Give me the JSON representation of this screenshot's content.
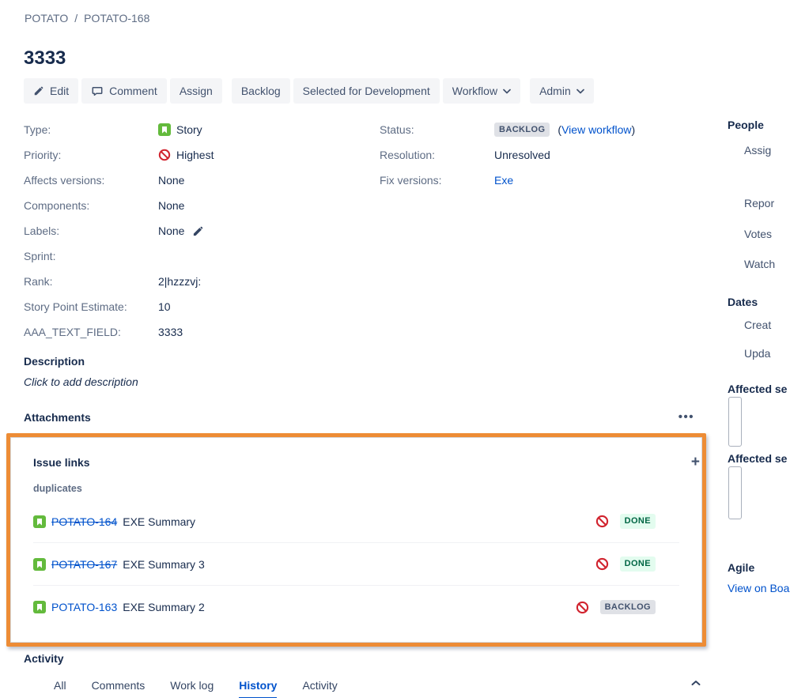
{
  "breadcrumb": {
    "project": "POTATO",
    "separator": "/",
    "issue": "POTATO-168"
  },
  "title": "3333",
  "toolbar": {
    "edit": "Edit",
    "comment": "Comment",
    "assign": "Assign",
    "backlog": "Backlog",
    "selected_for_development": "Selected for Development",
    "workflow": "Workflow",
    "admin": "Admin"
  },
  "details": {
    "left": [
      {
        "label": "Type:",
        "value": "Story"
      },
      {
        "label": "Priority:",
        "value": "Highest"
      },
      {
        "label": "Affects versions:",
        "value": "None"
      },
      {
        "label": "Components:",
        "value": "None"
      },
      {
        "label": "Labels:",
        "value": "None"
      },
      {
        "label": "Sprint:",
        "value": ""
      },
      {
        "label": "Rank:",
        "value": "2|hzzzvj:"
      },
      {
        "label": "Story Point Estimate:",
        "value": "10"
      },
      {
        "label": "AAA_TEXT_FIELD:",
        "value": "3333"
      }
    ],
    "right": {
      "status_label": "Status:",
      "status_badge": "BACKLOG",
      "paren_open": "(",
      "view_workflow": "View workflow",
      "paren_close": ")",
      "resolution_label": "Resolution:",
      "resolution_value": "Unresolved",
      "fix_versions_label": "Fix versions:",
      "fix_versions_value": "Exe"
    }
  },
  "description": {
    "heading": "Description",
    "placeholder": "Click to add description"
  },
  "attachments": {
    "heading": "Attachments",
    "more": "•••"
  },
  "issue_links": {
    "heading": "Issue links",
    "add": "+",
    "group": "duplicates",
    "items": [
      {
        "key": "POTATO-164",
        "summary": "EXE Summary",
        "status": "DONE"
      },
      {
        "key": "POTATO-167",
        "summary": "EXE Summary 3",
        "status": "DONE"
      },
      {
        "key": "POTATO-163",
        "summary": "EXE Summary 2",
        "status": "BACKLOG"
      }
    ]
  },
  "activity": {
    "heading": "Activity",
    "tabs": [
      "All",
      "Comments",
      "Work log",
      "History",
      "Activity"
    ],
    "active_tab": "History"
  },
  "sidebar": {
    "people_heading": "People",
    "assignee_label": "Assig",
    "reporter_label": "Repor",
    "votes_label": "Votes",
    "watchers_label": "Watch",
    "dates_heading": "Dates",
    "created_label": "Creat",
    "updated_label": "Upda",
    "affected_heading_1": "Affected se",
    "affected_heading_2": "Affected se",
    "agile_heading": "Agile",
    "agile_link": "View on Boa"
  },
  "colors": {
    "highlight_orange": "#ED8C35",
    "link_blue": "#0052CC",
    "story_green": "#63BA3C",
    "priority_red": "#D1242F",
    "done_badge_bg": "#E3FCEF",
    "done_badge_text": "#006644",
    "neutral_badge_bg": "#DFE1E6",
    "neutral_badge_text": "#42526E"
  }
}
